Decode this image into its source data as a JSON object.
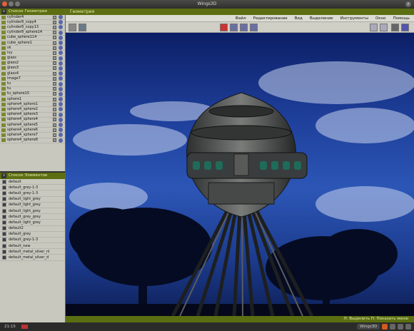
{
  "window": {
    "title": "Wings3D"
  },
  "geometry_bar": {
    "title": "Геометрия"
  },
  "menu": [
    "Файл",
    "Редактирование",
    "Вид",
    "Выделение",
    "Инструменты",
    "Окно",
    "Помощь"
  ],
  "status": {
    "text": "Л: Выделить   П: Показать меню"
  },
  "taskbar": {
    "clock": "21:15",
    "task": "Wings3D"
  },
  "colors": {
    "accent": "#5b6e12",
    "panel": "#c8c8be",
    "sky": "#1e3f9a"
  },
  "objects_panel": {
    "title": "Список Геометрии",
    "items": [
      "cylinder4",
      "cylinder8_copy4",
      "cylinder8_copy13",
      "cylinder8_sphere14",
      "cube_sphere114",
      "cube_sphere1",
      "sk",
      "ivy",
      "glass",
      "glass2",
      "glass3",
      "glass4",
      "image7",
      "tu",
      "tu",
      "tu_sphere15",
      "sphere1",
      "sphere4_sphere1",
      "sphere4_sphere2",
      "sphere4_sphere3",
      "sphere4_sphere4",
      "sphere4_sphere5",
      "sphere4_sphere6",
      "sphere4_sphere7",
      "sphere4_sphere8"
    ]
  },
  "materials_panel": {
    "title": "Список Элементов",
    "items": [
      "default",
      "default_grey-1-3",
      "default_grey-1-3",
      "default_light_grey",
      "default_light_grey",
      "default_light_grey",
      "default_grey_grey",
      "default_light_grey",
      "default2",
      "default_grey",
      "default_grey-1-3",
      "default_new",
      "default_metal_silver_nl",
      "default_metal_silver_d"
    ]
  }
}
